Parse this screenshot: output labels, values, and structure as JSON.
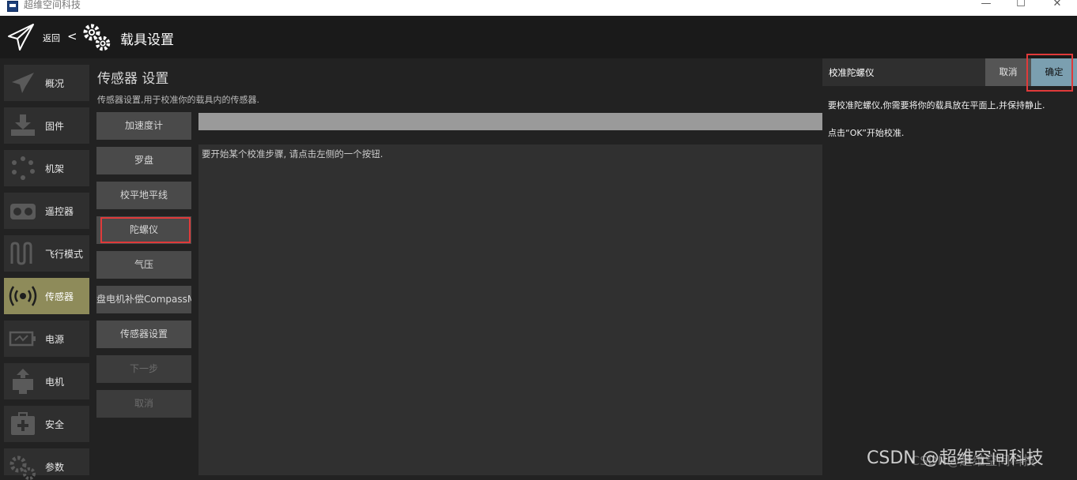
{
  "window": {
    "title": "超维空间科技",
    "controls": [
      "—",
      "☐",
      "✕"
    ]
  },
  "header": {
    "back_label": "返回",
    "chevron": "<",
    "page_title": "载具设置"
  },
  "nav": {
    "items": [
      {
        "label": "概况",
        "icon": "plane-icon"
      },
      {
        "label": "固件",
        "icon": "download-icon"
      },
      {
        "label": "机架",
        "icon": "frame-icon"
      },
      {
        "label": "遥控器",
        "icon": "remote-control-icon"
      },
      {
        "label": "飞行模式",
        "icon": "wave-icon"
      },
      {
        "label": "传感器",
        "icon": "sensor-icon",
        "active": true
      },
      {
        "label": "电源",
        "icon": "battery-icon"
      },
      {
        "label": "电机",
        "icon": "motor-icon"
      },
      {
        "label": "安全",
        "icon": "safety-kit-icon"
      },
      {
        "label": "参数",
        "icon": "gears-icon"
      }
    ]
  },
  "sensors": {
    "title": "传感器 设置",
    "description": "传感器设置,用于校准你的载具内的传感器.",
    "buttons": [
      {
        "label": "加速度计"
      },
      {
        "label": "罗盘"
      },
      {
        "label": "校平地平线"
      },
      {
        "label": "陀螺仪"
      },
      {
        "label": "气压"
      },
      {
        "label": "罗盘电机补偿CompassMot"
      },
      {
        "label": "传感器设置"
      },
      {
        "label": "下一步",
        "disabled": true
      },
      {
        "label": "取消",
        "disabled": true
      }
    ],
    "log_text": "要开始某个校准步骤, 请点击左侧的一个按钮."
  },
  "calibration_panel": {
    "title": "校准陀螺仪",
    "cancel_label": "取消",
    "ok_label": "确定",
    "instruction": "要校准陀螺仪,你需要将你的载具放在平面上,并保持静止.",
    "start_hint": "点击“OK”开始校准."
  },
  "watermark": {
    "text": "CSDN @超维空间科技",
    "ghost_text": "CSDN@超维空间科技"
  },
  "colors": {
    "active_nav": "#8e8b5a",
    "ok_button": "#7b9fb0",
    "highlight_box": "#e03a3a"
  }
}
